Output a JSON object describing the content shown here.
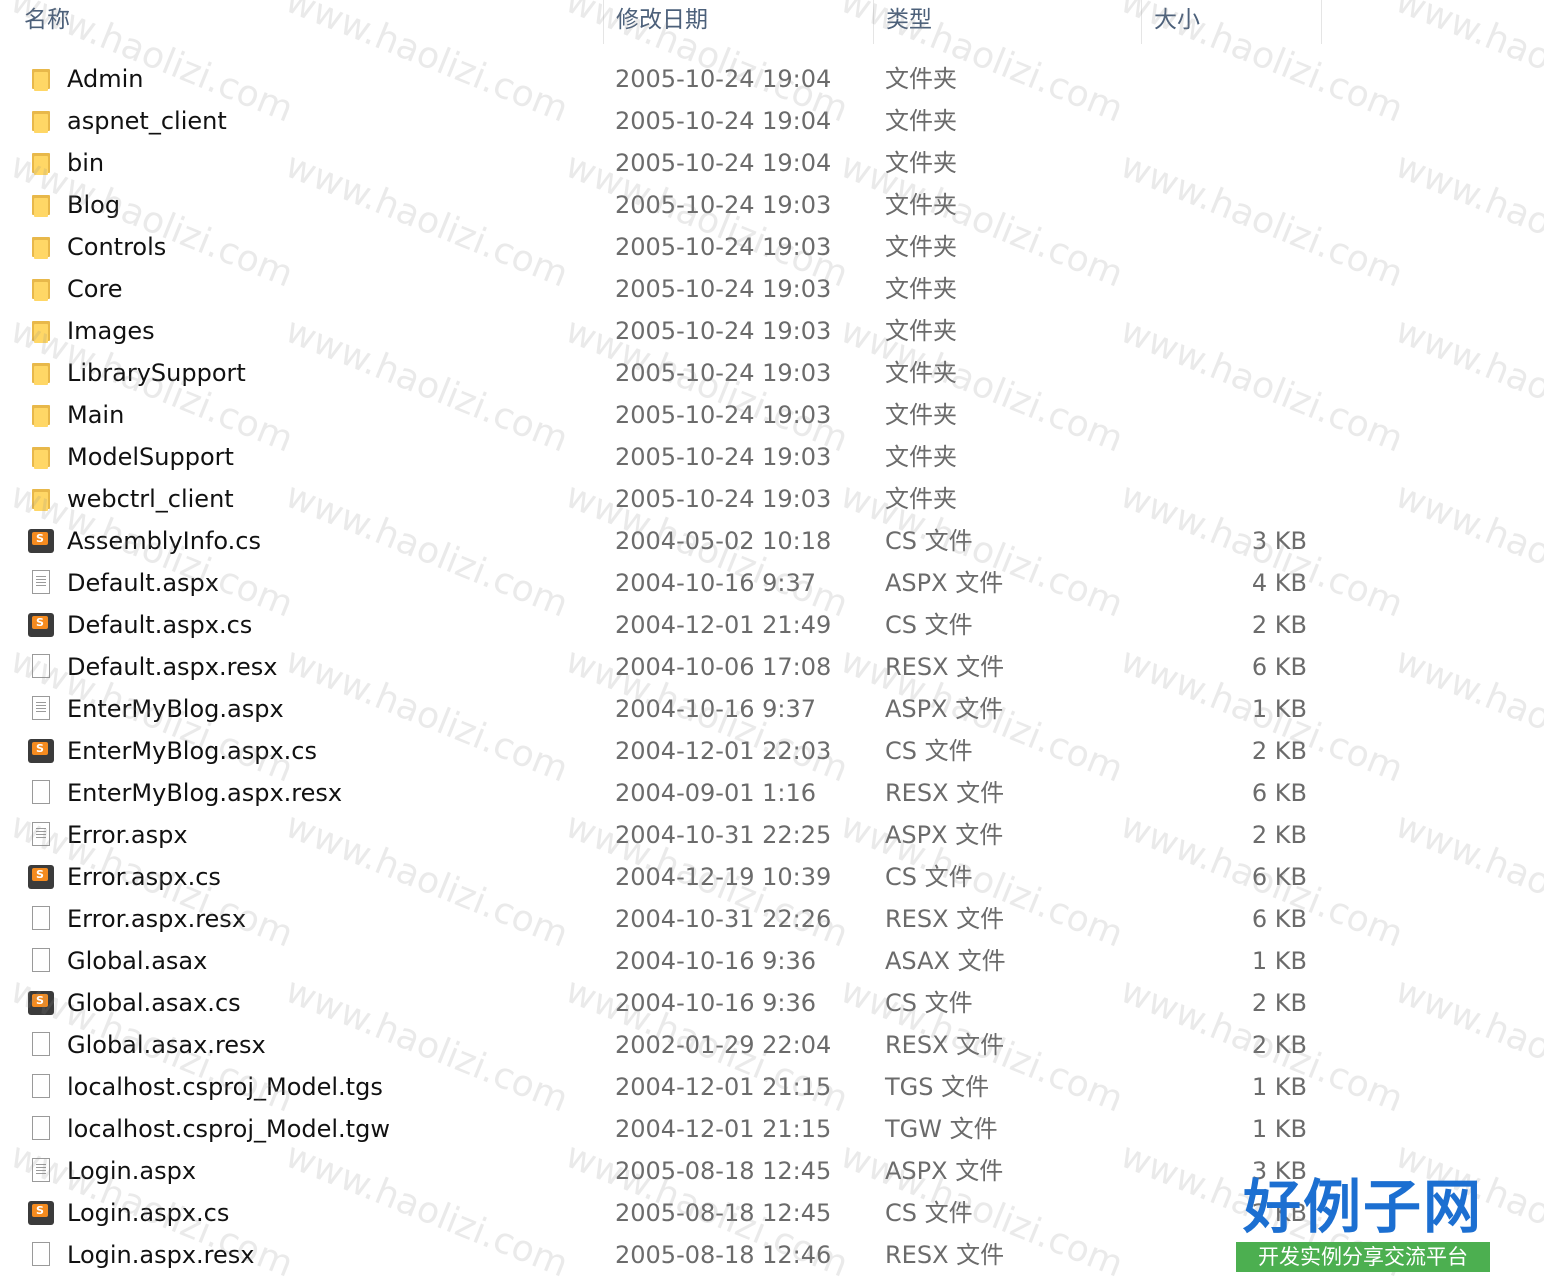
{
  "columns": {
    "name": "名称",
    "modified": "修改日期",
    "type": "类型",
    "size": "大小"
  },
  "files": [
    {
      "name": "Admin",
      "date": "2005-10-24 19:04",
      "type": "文件夹",
      "size": "",
      "icon": "folder-icon"
    },
    {
      "name": "aspnet_client",
      "date": "2005-10-24 19:04",
      "type": "文件夹",
      "size": "",
      "icon": "folder-icon"
    },
    {
      "name": "bin",
      "date": "2005-10-24 19:04",
      "type": "文件夹",
      "size": "",
      "icon": "folder-icon"
    },
    {
      "name": "Blog",
      "date": "2005-10-24 19:03",
      "type": "文件夹",
      "size": "",
      "icon": "folder-icon"
    },
    {
      "name": "Controls",
      "date": "2005-10-24 19:03",
      "type": "文件夹",
      "size": "",
      "icon": "folder-icon"
    },
    {
      "name": "Core",
      "date": "2005-10-24 19:03",
      "type": "文件夹",
      "size": "",
      "icon": "folder-icon"
    },
    {
      "name": "Images",
      "date": "2005-10-24 19:03",
      "type": "文件夹",
      "size": "",
      "icon": "folder-icon"
    },
    {
      "name": "LibrarySupport",
      "date": "2005-10-24 19:03",
      "type": "文件夹",
      "size": "",
      "icon": "folder-icon"
    },
    {
      "name": "Main",
      "date": "2005-10-24 19:03",
      "type": "文件夹",
      "size": "",
      "icon": "folder-icon"
    },
    {
      "name": "ModelSupport",
      "date": "2005-10-24 19:03",
      "type": "文件夹",
      "size": "",
      "icon": "folder-icon"
    },
    {
      "name": "webctrl_client",
      "date": "2005-10-24 19:03",
      "type": "文件夹",
      "size": "",
      "icon": "folder-icon"
    },
    {
      "name": "AssemblyInfo.cs",
      "date": "2004-05-02 10:18",
      "type": "CS 文件",
      "size": "3 KB",
      "icon": "csharp-file-icon"
    },
    {
      "name": "Default.aspx",
      "date": "2004-10-16 9:37",
      "type": "ASPX 文件",
      "size": "4 KB",
      "icon": "text-file-icon"
    },
    {
      "name": "Default.aspx.cs",
      "date": "2004-12-01 21:49",
      "type": "CS 文件",
      "size": "2 KB",
      "icon": "csharp-file-icon"
    },
    {
      "name": "Default.aspx.resx",
      "date": "2004-10-06 17:08",
      "type": "RESX 文件",
      "size": "6 KB",
      "icon": "blank-file-icon"
    },
    {
      "name": "EnterMyBlog.aspx",
      "date": "2004-10-16 9:37",
      "type": "ASPX 文件",
      "size": "1 KB",
      "icon": "text-file-icon"
    },
    {
      "name": "EnterMyBlog.aspx.cs",
      "date": "2004-12-01 22:03",
      "type": "CS 文件",
      "size": "2 KB",
      "icon": "csharp-file-icon"
    },
    {
      "name": "EnterMyBlog.aspx.resx",
      "date": "2004-09-01 1:16",
      "type": "RESX 文件",
      "size": "6 KB",
      "icon": "blank-file-icon"
    },
    {
      "name": "Error.aspx",
      "date": "2004-10-31 22:25",
      "type": "ASPX 文件",
      "size": "2 KB",
      "icon": "text-file-icon"
    },
    {
      "name": "Error.aspx.cs",
      "date": "2004-12-19 10:39",
      "type": "CS 文件",
      "size": "6 KB",
      "icon": "csharp-file-icon"
    },
    {
      "name": "Error.aspx.resx",
      "date": "2004-10-31 22:26",
      "type": "RESX 文件",
      "size": "6 KB",
      "icon": "blank-file-icon"
    },
    {
      "name": "Global.asax",
      "date": "2004-10-16 9:36",
      "type": "ASAX 文件",
      "size": "1 KB",
      "icon": "blank-file-icon"
    },
    {
      "name": "Global.asax.cs",
      "date": "2004-10-16 9:36",
      "type": "CS 文件",
      "size": "2 KB",
      "icon": "csharp-file-icon"
    },
    {
      "name": "Global.asax.resx",
      "date": "2002-01-29 22:04",
      "type": "RESX 文件",
      "size": "2 KB",
      "icon": "blank-file-icon"
    },
    {
      "name": "localhost.csproj_Model.tgs",
      "date": "2004-12-01 21:15",
      "type": "TGS 文件",
      "size": "1 KB",
      "icon": "blank-file-icon"
    },
    {
      "name": "localhost.csproj_Model.tgw",
      "date": "2004-12-01 21:15",
      "type": "TGW 文件",
      "size": "1 KB",
      "icon": "blank-file-icon"
    },
    {
      "name": "Login.aspx",
      "date": "2005-08-18 12:45",
      "type": "ASPX 文件",
      "size": "3 KB",
      "icon": "text-file-icon"
    },
    {
      "name": "Login.aspx.cs",
      "date": "2005-08-18 12:45",
      "type": "CS 文件",
      "size": "2 KB",
      "icon": "csharp-file-icon"
    },
    {
      "name": "Login.aspx.resx",
      "date": "2005-08-18 12:46",
      "type": "RESX 文件",
      "size": "",
      "icon": "blank-file-icon"
    }
  ],
  "watermark": "www.haolizi.com",
  "logo": {
    "title": "好例子网",
    "subtitle": "开发实例分享交流平台"
  }
}
